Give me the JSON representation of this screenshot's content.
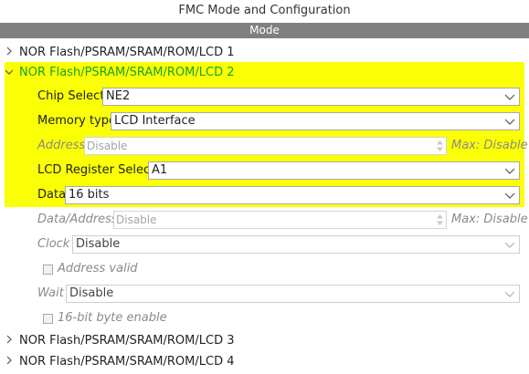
{
  "window": {
    "title": "FMC Mode and Configuration"
  },
  "mode_header": "Mode",
  "tree": {
    "nodes": [
      {
        "label": "NOR Flash/PSRAM/SRAM/ROM/LCD 1",
        "expanded": false
      },
      {
        "label": "NOR Flash/PSRAM/SRAM/ROM/LCD 2",
        "expanded": true
      },
      {
        "label": "NOR Flash/PSRAM/SRAM/ROM/LCD 3",
        "expanded": false
      },
      {
        "label": "NOR Flash/PSRAM/SRAM/ROM/LCD 4",
        "expanded": false
      }
    ]
  },
  "fields": {
    "chip_select": {
      "label": "Chip Select",
      "value": "NE2"
    },
    "memory_type": {
      "label": "Memory type",
      "value": "LCD Interface"
    },
    "address": {
      "label": "Address",
      "value": "Disable",
      "max": "Max: Disable"
    },
    "lcd_register_select": {
      "label": "LCD Register Select",
      "value": "A1"
    },
    "data": {
      "label": "Data",
      "value": "16 bits"
    },
    "data_address": {
      "label": "Data/Address",
      "value": "Disable",
      "max": "Max: Disable"
    },
    "clock": {
      "label": "Clock",
      "value": "Disable"
    },
    "address_valid": {
      "label": "Address valid",
      "checked": false
    },
    "wait": {
      "label": "Wait",
      "value": "Disable"
    },
    "byte_enable": {
      "label": "16-bit byte enable",
      "checked": false
    }
  },
  "colors": {
    "highlight": "#fbff05",
    "selected_text": "#1aa21a",
    "header_bg": "#808080"
  }
}
